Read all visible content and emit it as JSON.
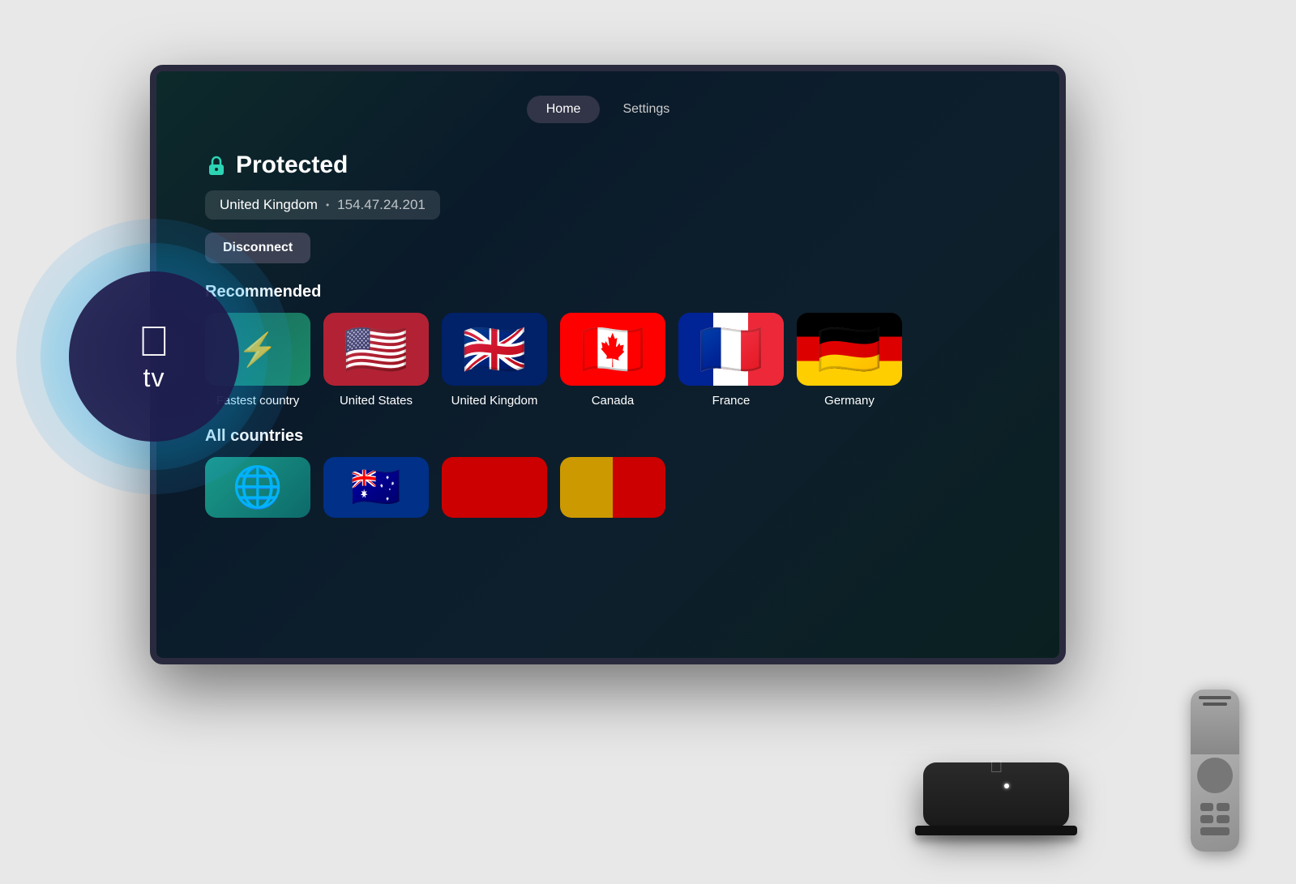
{
  "nav": {
    "home_label": "Home",
    "settings_label": "Settings"
  },
  "status": {
    "protected_label": "Protected",
    "country": "United Kingdom",
    "ip": "154.47.24.201",
    "disconnect_label": "Disconnect"
  },
  "recommended": {
    "section_title": "Recommended",
    "countries": [
      {
        "id": "fastest",
        "label": "Fastest country",
        "type": "fastest"
      },
      {
        "id": "us",
        "label": "United States",
        "type": "flag",
        "emoji": "🇺🇸"
      },
      {
        "id": "uk",
        "label": "United Kingdom",
        "type": "flag",
        "emoji": "🇬🇧"
      },
      {
        "id": "ca",
        "label": "Canada",
        "type": "flag",
        "emoji": "🇨🇦"
      },
      {
        "id": "fr",
        "label": "France",
        "type": "flag",
        "emoji": "🇫🇷"
      },
      {
        "id": "de",
        "label": "Germany",
        "type": "flag",
        "emoji": "🇩🇪"
      }
    ]
  },
  "all_countries": {
    "section_title": "All countries"
  },
  "appletv": {
    "logo": "",
    "tv_label": "tv"
  }
}
